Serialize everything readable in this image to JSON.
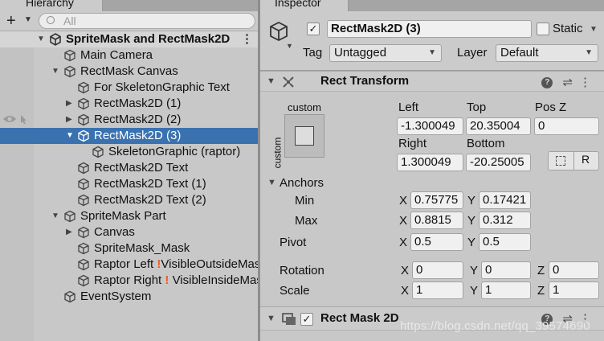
{
  "hierarchy": {
    "tab_label": "Hierarchy",
    "search_placeholder": "All",
    "scene_name": "SpriteMask and RectMask2D",
    "items": [
      {
        "label": "Main Camera"
      },
      {
        "label": "RectMask Canvas"
      },
      {
        "label": "For SkeletonGraphic Text"
      },
      {
        "label": "RectMask2D (1)"
      },
      {
        "label": "RectMask2D (2)"
      },
      {
        "label": "RectMask2D (3)"
      },
      {
        "label": "SkeletonGraphic (raptor)"
      },
      {
        "label": "RectMask2D Text"
      },
      {
        "label": "RectMask2D Text (1)"
      },
      {
        "label": "RectMask2D Text (2)"
      },
      {
        "label": "SpriteMask Part"
      },
      {
        "label": "Canvas"
      },
      {
        "label": "SpriteMask_Mask"
      },
      {
        "label": "Raptor Left",
        "warn": "!",
        "suffix": "VisibleOutsideMask"
      },
      {
        "label": "Raptor Right",
        "warn": "!",
        "suffix": "VisibleInsideMask"
      },
      {
        "label": "EventSystem"
      }
    ]
  },
  "inspector": {
    "tab_label": "Inspector",
    "object_name": "RectMask2D (3)",
    "active_checked": "✓",
    "static_label": "Static",
    "tag_label": "Tag",
    "tag_value": "Untagged",
    "layer_label": "Layer",
    "layer_value": "Default",
    "rect_transform": {
      "title": "Rect Transform",
      "anchor_preset_label": "custom",
      "anchor_preset_side_label": "custom",
      "left_label": "Left",
      "left": "-1.300049",
      "top_label": "Top",
      "top": "20.35004",
      "posz_label": "Pos Z",
      "posz": "0",
      "right_label": "Right",
      "right": "1.300049",
      "bottom_label": "Bottom",
      "bottom": "-20.25005",
      "raw_button": "R",
      "anchors_label": "Anchors",
      "min_label": "Min",
      "min_x": "0.75775",
      "min_y": "0.17421",
      "max_label": "Max",
      "max_x": "0.8815",
      "max_y": "0.312",
      "pivot_label": "Pivot",
      "pivot_x": "0.5",
      "pivot_y": "0.5",
      "rotation_label": "Rotation",
      "rot_x": "0",
      "rot_y": "0",
      "rot_z": "0",
      "scale_label": "Scale",
      "scale_x": "1",
      "scale_y": "1",
      "scale_z": "1",
      "x": "X",
      "y": "Y",
      "z": "Z"
    },
    "rect_mask": {
      "title": "Rect Mask 2D",
      "enabled": "✓"
    }
  },
  "watermark": "https://blog.csdn.net/qq_39574690"
}
